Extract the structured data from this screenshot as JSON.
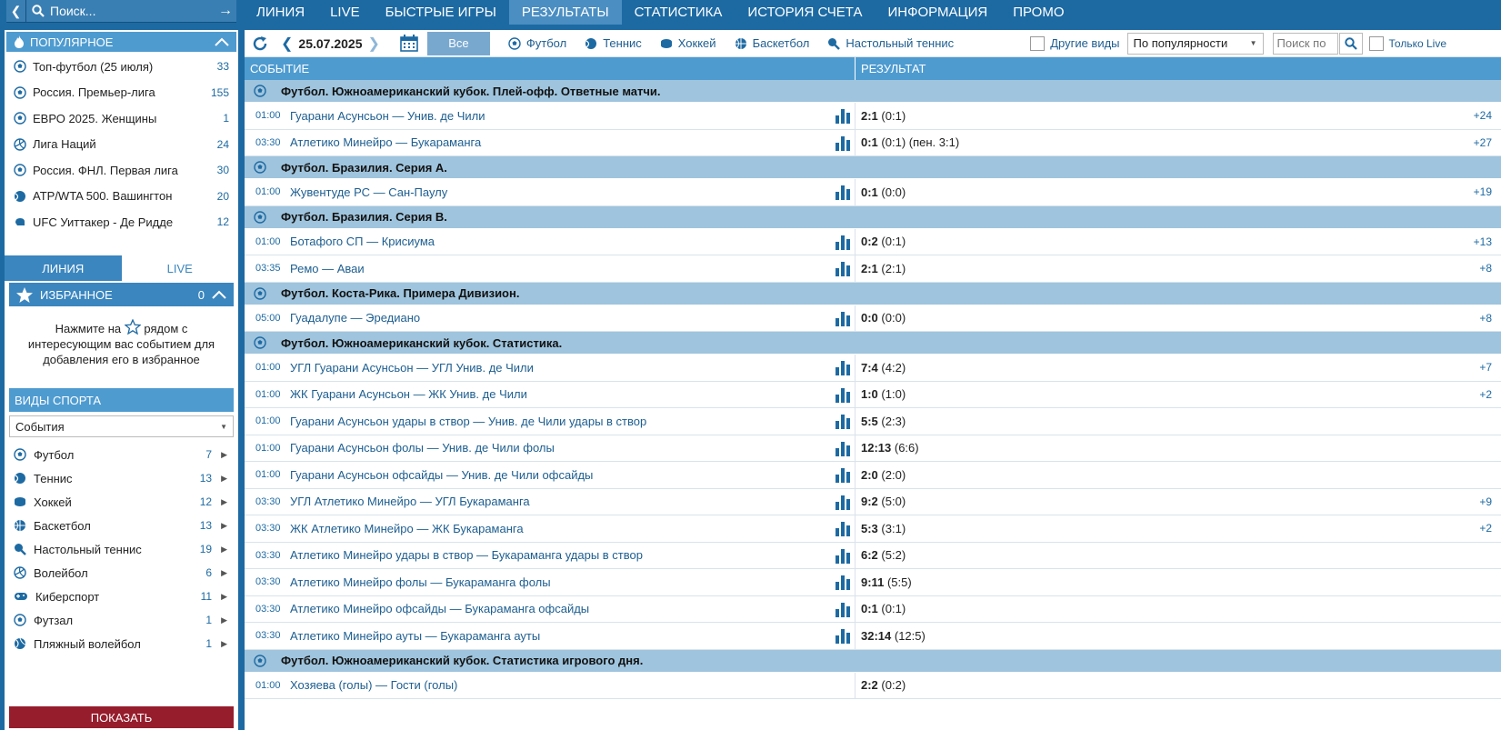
{
  "search": {
    "placeholder": "Поиск..."
  },
  "nav": [
    {
      "label": "ЛИНИЯ",
      "active": false
    },
    {
      "label": "LIVE",
      "active": false
    },
    {
      "label": "БЫСТРЫЕ ИГРЫ",
      "active": false
    },
    {
      "label": "РЕЗУЛЬТАТЫ",
      "active": true
    },
    {
      "label": "СТАТИСТИКА",
      "active": false
    },
    {
      "label": "ИСТОРИЯ СЧЕТА",
      "active": false
    },
    {
      "label": "ИНФОРМАЦИЯ",
      "active": false
    },
    {
      "label": "ПРОМО",
      "active": false
    }
  ],
  "popular": {
    "title": "ПОПУЛЯРНОЕ",
    "items": [
      {
        "icon": "football-icon",
        "name": "Топ-футбол (25 июля)",
        "count": "33"
      },
      {
        "icon": "football-icon",
        "name": "Россия. Премьер-лига",
        "count": "155"
      },
      {
        "icon": "football-icon",
        "name": "ЕВРО 2025. Женщины",
        "count": "1"
      },
      {
        "icon": "volleyball-icon",
        "name": "Лига Наций",
        "count": "24"
      },
      {
        "icon": "football-icon",
        "name": "Россия. ФНЛ. Первая лига",
        "count": "30"
      },
      {
        "icon": "tennis-icon",
        "name": "ATP/WTA 500. Вашингтон",
        "count": "20"
      },
      {
        "icon": "mma-icon",
        "name": "UFC Уиттакер - Де Ридде",
        "count": "12"
      }
    ]
  },
  "side_tabs": {
    "line": "ЛИНИЯ",
    "live": "LIVE"
  },
  "favorites": {
    "title": "ИЗБРАННОЕ",
    "count": "0",
    "hint_before": "Нажмите на",
    "hint_after": "рядом с интересующим вас событием для добавления его в избранное"
  },
  "sports": {
    "title": "ВИДЫ СПОРТА",
    "select_value": "События",
    "items": [
      {
        "icon": "football-icon",
        "name": "Футбол",
        "count": "7"
      },
      {
        "icon": "tennis-icon",
        "name": "Теннис",
        "count": "13"
      },
      {
        "icon": "hockey-icon",
        "name": "Хоккей",
        "count": "12"
      },
      {
        "icon": "basketball-icon",
        "name": "Баскетбол",
        "count": "13"
      },
      {
        "icon": "table-tennis-icon",
        "name": "Настольный теннис",
        "count": "19"
      },
      {
        "icon": "volleyball-icon",
        "name": "Волейбол",
        "count": "6"
      },
      {
        "icon": "esports-icon",
        "name": "Киберспорт",
        "count": "11"
      },
      {
        "icon": "futsal-icon",
        "name": "Футзал",
        "count": "1"
      },
      {
        "icon": "beach-volleyball-icon",
        "name": "Пляжный волейбол",
        "count": "1"
      }
    ],
    "show_button": "ПОКАЗАТЬ"
  },
  "toolbar": {
    "date": "25.07.2025",
    "all_label": "Все",
    "filters": [
      {
        "icon": "football-icon",
        "label": "Футбол"
      },
      {
        "icon": "tennis-icon",
        "label": "Теннис"
      },
      {
        "icon": "hockey-icon",
        "label": "Хоккей"
      },
      {
        "icon": "basketball-icon",
        "label": "Баскетбол"
      },
      {
        "icon": "table-tennis-icon",
        "label": "Настольный теннис"
      }
    ],
    "other_label": "Другие виды",
    "sort_value": "По популярности",
    "search_placeholder": "Поиск по",
    "only_live": "Только Live"
  },
  "table": {
    "col_event": "СОБЫТИЕ",
    "col_result": "РЕЗУЛЬТАТ",
    "groups": [
      {
        "title": "Футбол. Южноамериканский кубок. Плей-офф. Ответные матчи.",
        "rows": [
          {
            "time": "01:00",
            "event": "Гуарани Асунсьон — Унив. де Чили",
            "score": "2:1",
            "detail": "(0:1)",
            "more": "+24",
            "stat": true
          },
          {
            "time": "03:30",
            "event": "Атлетико Минейро — Букараманга",
            "score": "0:1",
            "detail": "(0:1) (пен. 3:1)",
            "more": "+27",
            "stat": true
          }
        ]
      },
      {
        "title": "Футбол. Бразилия. Серия A.",
        "rows": [
          {
            "time": "01:00",
            "event": "Жувентуде РС — Сан-Паулу",
            "score": "0:1",
            "detail": "(0:0)",
            "more": "+19",
            "stat": true
          }
        ]
      },
      {
        "title": "Футбол. Бразилия. Серия B.",
        "rows": [
          {
            "time": "01:00",
            "event": "Ботафого СП — Крисиума",
            "score": "0:2",
            "detail": "(0:1)",
            "more": "+13",
            "stat": true
          },
          {
            "time": "03:35",
            "event": "Ремо — Аваи",
            "score": "2:1",
            "detail": "(2:1)",
            "more": "+8",
            "stat": true
          }
        ]
      },
      {
        "title": "Футбол. Коста-Рика. Примера Дивизион.",
        "rows": [
          {
            "time": "05:00",
            "event": "Гуадалупе — Эредиано",
            "score": "0:0",
            "detail": "(0:0)",
            "more": "+8",
            "stat": true
          }
        ]
      },
      {
        "title": "Футбол. Южноамериканский кубок. Статистика.",
        "rows": [
          {
            "time": "01:00",
            "event": "УГЛ Гуарани Асунсьон — УГЛ Унив. де Чили",
            "score": "7:4",
            "detail": "(4:2)",
            "more": "+7",
            "stat": true
          },
          {
            "time": "01:00",
            "event": "ЖК Гуарани Асунсьон — ЖК Унив. де Чили",
            "score": "1:0",
            "detail": "(1:0)",
            "more": "+2",
            "stat": true
          },
          {
            "time": "01:00",
            "event": "Гуарани Асунсьон удары в створ — Унив. де Чили удары в створ",
            "score": "5:5",
            "detail": "(2:3)",
            "more": "",
            "stat": true
          },
          {
            "time": "01:00",
            "event": "Гуарани Асунсьон фолы — Унив. де Чили фолы",
            "score": "12:13",
            "detail": "(6:6)",
            "more": "",
            "stat": true
          },
          {
            "time": "01:00",
            "event": "Гуарани Асунсьон офсайды — Унив. де Чили офсайды",
            "score": "2:0",
            "detail": "(2:0)",
            "more": "",
            "stat": true
          },
          {
            "time": "03:30",
            "event": "УГЛ Атлетико Минейро — УГЛ Букараманга",
            "score": "9:2",
            "detail": "(5:0)",
            "more": "+9",
            "stat": true
          },
          {
            "time": "03:30",
            "event": "ЖК Атлетико Минейро — ЖК Букараманга",
            "score": "5:3",
            "detail": "(3:1)",
            "more": "+2",
            "stat": true
          },
          {
            "time": "03:30",
            "event": "Атлетико Минейро удары в створ — Букараманга удары в створ",
            "score": "6:2",
            "detail": "(5:2)",
            "more": "",
            "stat": true
          },
          {
            "time": "03:30",
            "event": "Атлетико Минейро фолы — Букараманга фолы",
            "score": "9:11",
            "detail": "(5:5)",
            "more": "",
            "stat": true
          },
          {
            "time": "03:30",
            "event": "Атлетико Минейро офсайды — Букараманга офсайды",
            "score": "0:1",
            "detail": "(0:1)",
            "more": "",
            "stat": true
          },
          {
            "time": "03:30",
            "event": "Атлетико Минейро ауты — Букараманга ауты",
            "score": "32:14",
            "detail": "(12:5)",
            "more": "",
            "stat": true
          }
        ]
      },
      {
        "title": "Футбол. Южноамериканский кубок. Статистика игрового дня.",
        "rows": [
          {
            "time": "01:00",
            "event": "Хозяева (голы) — Гости (голы)",
            "score": "2:2",
            "detail": "(0:2)",
            "more": "",
            "stat": false
          }
        ]
      }
    ]
  }
}
